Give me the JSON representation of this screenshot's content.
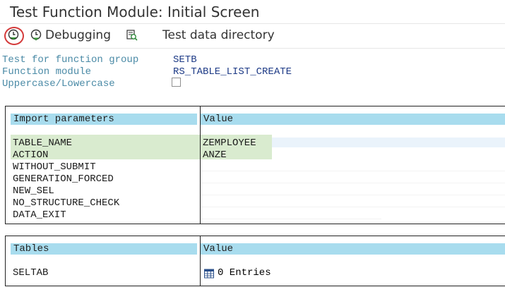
{
  "window": {
    "title": "Test Function Module: Initial Screen"
  },
  "toolbar": {
    "execute_icon": "execute-clock-icon",
    "debugging_label": "Debugging",
    "test_data_label": "Test data directory"
  },
  "header": {
    "group_label": "Test for function group",
    "group_value": "SETB",
    "module_label": "Function module",
    "module_value": "RS_TABLE_LIST_CREATE",
    "case_label": "Uppercase/Lowercase",
    "case_checked": false
  },
  "imports": {
    "col_name": "Import parameters",
    "col_value": "Value",
    "rows": [
      {
        "name": "TABLE_NAME",
        "value": "ZEMPLOYEE"
      },
      {
        "name": "ACTION",
        "value": "ANZE"
      },
      {
        "name": "WITHOUT_SUBMIT",
        "value": ""
      },
      {
        "name": "GENERATION_FORCED",
        "value": ""
      },
      {
        "name": "NEW_SEL",
        "value": ""
      },
      {
        "name": "NO_STRUCTURE_CHECK",
        "value": ""
      },
      {
        "name": "DATA_EXIT",
        "value": ""
      }
    ]
  },
  "tables": {
    "col_name": "Tables",
    "col_value": "Value",
    "rows": [
      {
        "name": "SELTAB",
        "value": "0 Entries",
        "icon": "table-grid-icon"
      }
    ]
  }
}
